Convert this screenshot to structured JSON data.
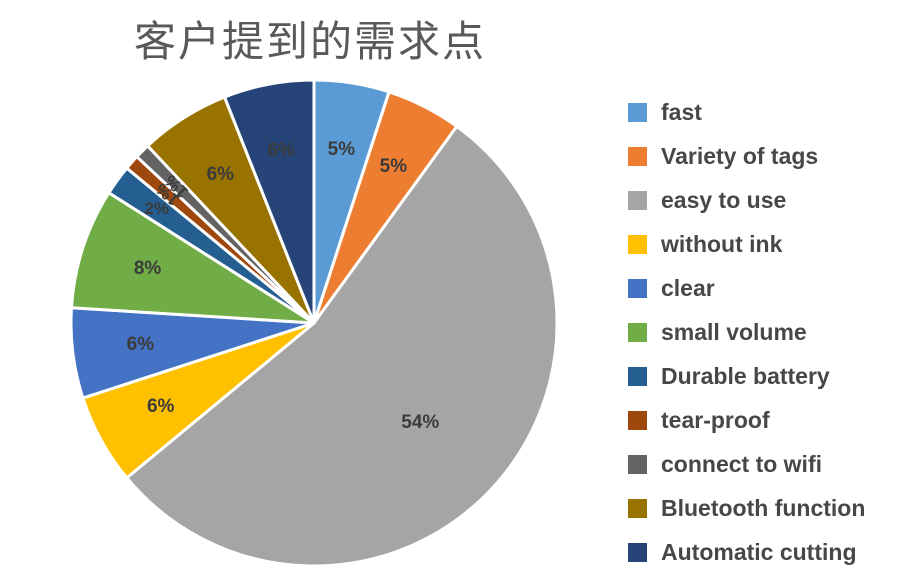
{
  "chart": {
    "title": "客户提到的需求点",
    "title_color": "#595959",
    "label_color": "#3b3b3b",
    "legend_text_color": "#474747",
    "background": "#ffffff"
  },
  "chart_data": {
    "type": "pie",
    "title": "客户提到的需求点",
    "legend_position": "right",
    "start_angle_deg": 0,
    "direction": "clockwise",
    "slice_border_color": "#ffffff",
    "categories": [
      "fast",
      "Variety of tags",
      "easy to use",
      "without ink",
      "clear",
      "small volume",
      "Durable battery",
      "tear-proof",
      "connect to wifi",
      "Bluetooth function",
      "Automatic cutting"
    ],
    "values": [
      5,
      5,
      54,
      6,
      6,
      8,
      2,
      1,
      1,
      6,
      6
    ],
    "value_labels": [
      "5%",
      "5%",
      "54%",
      "6%",
      "6%",
      "8%",
      "2%",
      "1%",
      "1%",
      "6%",
      "6%"
    ],
    "colors": [
      "#5b9bd5",
      "#ed7d31",
      "#a5a5a5",
      "#ffc000",
      "#4472c4",
      "#70ad47",
      "#255e91",
      "#9e480e",
      "#636363",
      "#997300",
      "#264478"
    ],
    "slices": [
      {
        "label": "fast",
        "value": 5,
        "value_label": "5%",
        "color": "#5b9bd5"
      },
      {
        "label": "Variety of tags",
        "value": 5,
        "value_label": "5%",
        "color": "#ed7d31"
      },
      {
        "label": "easy to use",
        "value": 54,
        "value_label": "54%",
        "color": "#a5a5a5"
      },
      {
        "label": "without ink",
        "value": 6,
        "value_label": "6%",
        "color": "#ffc000"
      },
      {
        "label": "clear",
        "value": 6,
        "value_label": "6%",
        "color": "#4472c4"
      },
      {
        "label": "small volume",
        "value": 8,
        "value_label": "8%",
        "color": "#70ad47"
      },
      {
        "label": "Durable battery",
        "value": 2,
        "value_label": "2%",
        "color": "#255e91"
      },
      {
        "label": "tear-proof",
        "value": 1,
        "value_label": "1%",
        "color": "#9e480e"
      },
      {
        "label": "connect to wifi",
        "value": 1,
        "value_label": "1%",
        "color": "#636363"
      },
      {
        "label": "Bluetooth function",
        "value": 6,
        "value_label": "6%",
        "color": "#997300"
      },
      {
        "label": "Automatic cutting",
        "value": 6,
        "value_label": "6%",
        "color": "#264478"
      }
    ]
  },
  "legend": {
    "items": [
      {
        "label": "fast",
        "color": "#5b9bd5"
      },
      {
        "label": "Variety of tags",
        "color": "#ed7d31"
      },
      {
        "label": "easy to use",
        "color": "#a5a5a5"
      },
      {
        "label": "without ink",
        "color": "#ffc000"
      },
      {
        "label": "clear",
        "color": "#4472c4"
      },
      {
        "label": "small volume",
        "color": "#70ad47"
      },
      {
        "label": "Durable battery",
        "color": "#255e91"
      },
      {
        "label": "tear-proof",
        "color": "#9e480e"
      },
      {
        "label": "connect to wifi",
        "color": "#636363"
      },
      {
        "label": "Bluetooth function",
        "color": "#997300"
      },
      {
        "label": "Automatic cutting",
        "color": "#264478"
      }
    ]
  }
}
